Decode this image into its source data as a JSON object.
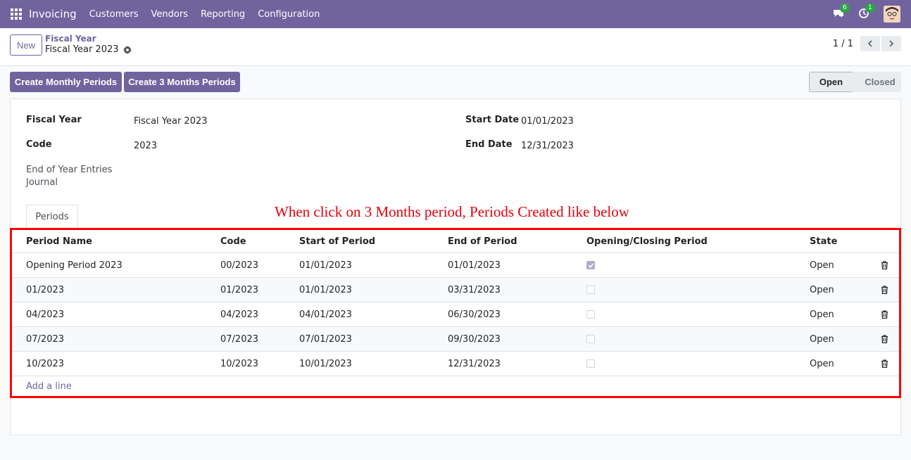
{
  "navbar": {
    "app_name": "Invoicing",
    "menu": [
      "Customers",
      "Vendors",
      "Reporting",
      "Configuration"
    ],
    "messages_count": "6",
    "activities_count": "1",
    "color": "#71639e"
  },
  "control_panel": {
    "new_label": "New",
    "breadcrumb_parent": "Fiscal Year",
    "breadcrumb_current": "Fiscal Year 2023",
    "pager": "1 / 1"
  },
  "actions": {
    "monthly_label": "Create Monthly Periods",
    "quarterly_label": "Create 3 Months Periods"
  },
  "status": {
    "open_label": "Open",
    "closed_label": "Closed",
    "current": "Open"
  },
  "form": {
    "fiscal_year_label": "Fiscal Year",
    "fiscal_year_value": "Fiscal Year 2023",
    "code_label": "Code",
    "code_value": "2023",
    "journal_label": "End of Year Entries Journal",
    "start_date_label": "Start Date",
    "start_date_value": "01/01/2023",
    "end_date_label": "End Date",
    "end_date_value": "12/31/2023"
  },
  "tabs": {
    "periods_label": "Periods"
  },
  "annotation": "When click on 3 Months period, Periods Created like below",
  "periods": {
    "headers": [
      "Period Name",
      "Code",
      "Start of Period",
      "End of Period",
      "Opening/Closing Period",
      "State"
    ],
    "rows": [
      {
        "name": "Opening Period 2023",
        "code": "00/2023",
        "start": "01/01/2023",
        "end": "01/01/2023",
        "opening": true,
        "state": "Open"
      },
      {
        "name": "01/2023",
        "code": "01/2023",
        "start": "01/01/2023",
        "end": "03/31/2023",
        "opening": false,
        "state": "Open"
      },
      {
        "name": "04/2023",
        "code": "04/2023",
        "start": "04/01/2023",
        "end": "06/30/2023",
        "opening": false,
        "state": "Open"
      },
      {
        "name": "07/2023",
        "code": "07/2023",
        "start": "07/01/2023",
        "end": "09/30/2023",
        "opening": false,
        "state": "Open"
      },
      {
        "name": "10/2023",
        "code": "10/2023",
        "start": "10/01/2023",
        "end": "12/31/2023",
        "opening": false,
        "state": "Open"
      }
    ],
    "add_line_label": "Add a line"
  }
}
